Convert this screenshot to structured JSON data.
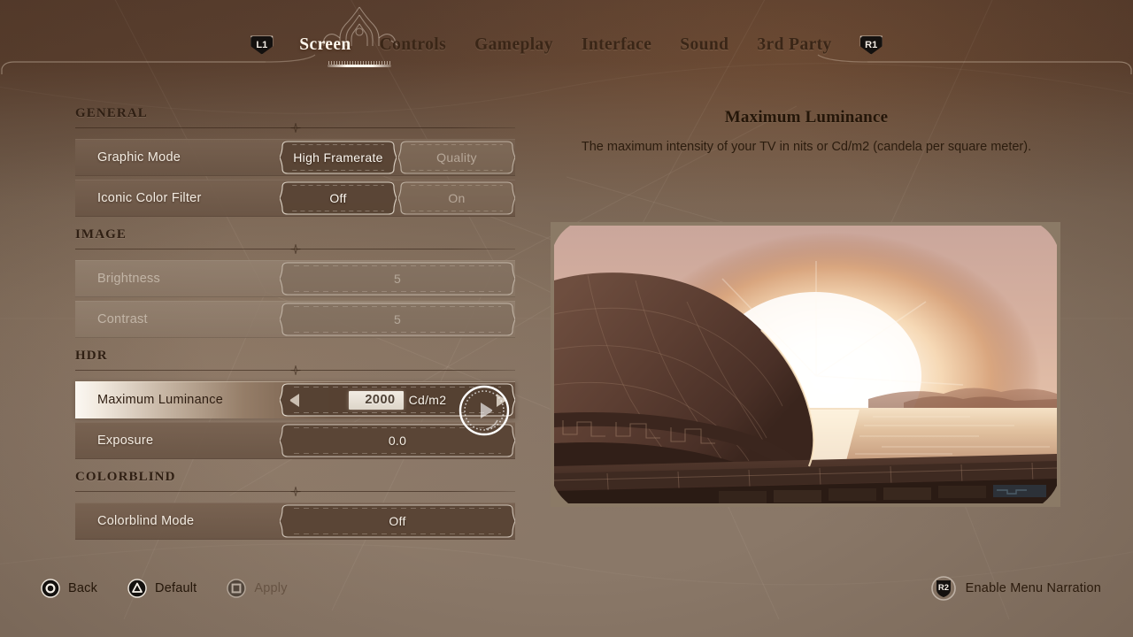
{
  "header": {
    "prev_shoulder": "L1",
    "next_shoulder": "R1",
    "tabs": [
      {
        "label": "Screen",
        "active": true
      },
      {
        "label": "Controls",
        "active": false
      },
      {
        "label": "Gameplay",
        "active": false
      },
      {
        "label": "Interface",
        "active": false
      },
      {
        "label": "Sound",
        "active": false
      },
      {
        "label": "3rd Party",
        "active": false
      }
    ]
  },
  "settings": {
    "sections": [
      {
        "title": "GENERAL",
        "rows": [
          {
            "label": "Graphic Mode",
            "type": "toggle",
            "state": "normal",
            "options": [
              "High Framerate",
              "Quality"
            ],
            "selected_index": 0
          },
          {
            "label": "Iconic Color Filter",
            "type": "toggle",
            "state": "normal",
            "options": [
              "Off",
              "On"
            ],
            "selected_index": 0
          }
        ]
      },
      {
        "title": "IMAGE",
        "rows": [
          {
            "label": "Brightness",
            "type": "value",
            "state": "disabled",
            "value": "5"
          },
          {
            "label": "Contrast",
            "type": "value",
            "state": "disabled",
            "value": "5"
          }
        ]
      },
      {
        "title": "HDR",
        "rows": [
          {
            "label": "Maximum Luminance",
            "type": "stepper",
            "state": "selected",
            "value": "2000",
            "unit": "Cd/m2",
            "left_arrow": "left-arrow-icon",
            "right_arrow": "right-arrow-icon"
          },
          {
            "label": "Exposure",
            "type": "value",
            "state": "normal",
            "value": "0.0"
          }
        ]
      },
      {
        "title": "COLORBLIND",
        "rows": [
          {
            "label": "Colorblind Mode",
            "type": "value",
            "state": "normal",
            "value": "Off"
          }
        ]
      }
    ]
  },
  "info": {
    "title": "Maximum Luminance",
    "description": "The maximum intensity of your TV in nits or Cd/m2 (candela per square meter).",
    "preview_alt": "hdr-calibration-preview"
  },
  "footer": {
    "left_hints": [
      {
        "glyph": "circle-button-icon",
        "label": "Back",
        "enabled": true
      },
      {
        "glyph": "triangle-button-icon",
        "label": "Default",
        "enabled": true
      },
      {
        "glyph": "square-button-icon",
        "label": "Apply",
        "enabled": false
      }
    ],
    "right_hint": {
      "glyph": "R2",
      "label": "Enable Menu Narration"
    }
  },
  "theme": {
    "bg_top": "#5b4030",
    "bg_bottom": "#8a7868",
    "row_fill": "#77614f",
    "row_fill_disabled": "#958372",
    "text_light": "#f3ece2",
    "text_dark": "#2f1f13",
    "accent_white": "#fff8ee",
    "badge_dark": "#14110f"
  }
}
